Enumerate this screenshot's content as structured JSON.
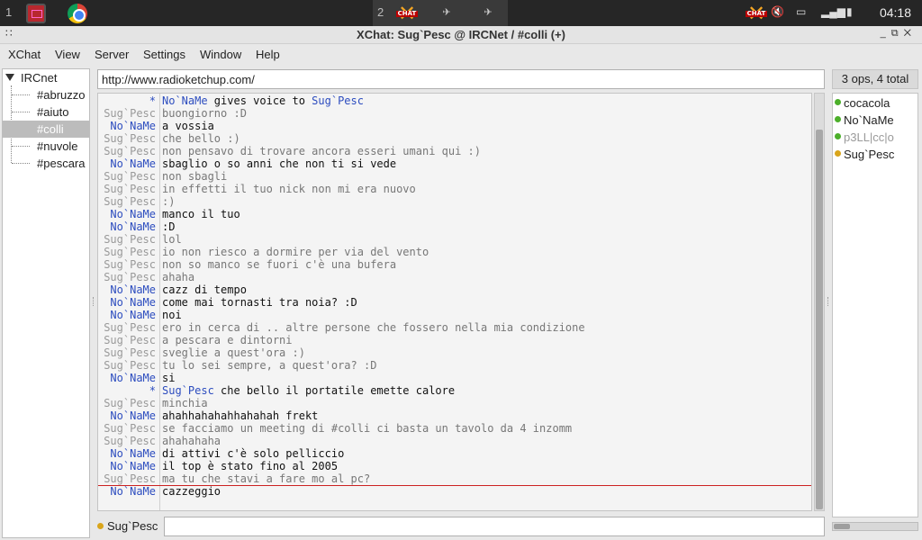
{
  "panel": {
    "workspace_1": "1",
    "workspace_2": "2",
    "xchat_icon_label": "CHAT",
    "clock": "04:18"
  },
  "window": {
    "title": "XChat: Sug`Pesc @ IRCNet / #colli (+)"
  },
  "menu": [
    "XChat",
    "View",
    "Server",
    "Settings",
    "Window",
    "Help"
  ],
  "tree": {
    "network": "IRCnet",
    "channels": [
      "#abruzzo",
      "#aiuto",
      "#colli",
      "#nuvole",
      "#pescara"
    ],
    "selected": "#colli"
  },
  "topic": "http://www.radioketchup.com/",
  "chat": [
    {
      "nick": "*",
      "text": "No`NaMe gives voice to Sug`Pesc",
      "kind": "action"
    },
    {
      "nick": "Sug`Pesc",
      "text": "buongiorno :D",
      "kind": "sug"
    },
    {
      "nick": "No`NaMe",
      "text": "a vossia",
      "kind": "no"
    },
    {
      "nick": "Sug`Pesc",
      "text": "che bello :)",
      "kind": "sug"
    },
    {
      "nick": "Sug`Pesc",
      "text": "non pensavo di trovare ancora esseri umani qui :)",
      "kind": "sug"
    },
    {
      "nick": "No`NaMe",
      "text": "sbaglio o so anni che non ti si vede",
      "kind": "no"
    },
    {
      "nick": "Sug`Pesc",
      "text": "non sbagli",
      "kind": "sug"
    },
    {
      "nick": "Sug`Pesc",
      "text": "in effetti il tuo nick non mi era nuovo",
      "kind": "sug"
    },
    {
      "nick": "Sug`Pesc",
      "text": ":)",
      "kind": "sug"
    },
    {
      "nick": "No`NaMe",
      "text": "manco il tuo",
      "kind": "no"
    },
    {
      "nick": "No`NaMe",
      "text": ":D",
      "kind": "no"
    },
    {
      "nick": "Sug`Pesc",
      "text": "lol",
      "kind": "sug"
    },
    {
      "nick": "Sug`Pesc",
      "text": "io non riesco a dormire per via del vento",
      "kind": "sug"
    },
    {
      "nick": "Sug`Pesc",
      "text": "non so manco se fuori c'è una bufera",
      "kind": "sug"
    },
    {
      "nick": "Sug`Pesc",
      "text": "ahaha",
      "kind": "sug"
    },
    {
      "nick": "No`NaMe",
      "text": "cazz di tempo",
      "kind": "no"
    },
    {
      "nick": "No`NaMe",
      "text": "come mai tornasti tra noia? :D",
      "kind": "no"
    },
    {
      "nick": "No`NaMe",
      "text": "noi",
      "kind": "no"
    },
    {
      "nick": "Sug`Pesc",
      "text": "ero in cerca di .. altre persone che fossero nella mia condizione",
      "kind": "sug"
    },
    {
      "nick": "Sug`Pesc",
      "text": "a pescara e dintorni",
      "kind": "sug"
    },
    {
      "nick": "Sug`Pesc",
      "text": "sveglie a quest'ora :)",
      "kind": "sug"
    },
    {
      "nick": "Sug`Pesc",
      "text": "tu lo sei sempre, a quest'ora? :D",
      "kind": "sug"
    },
    {
      "nick": "No`NaMe",
      "text": "si",
      "kind": "no"
    },
    {
      "nick": "*",
      "text": "Sug`Pesc che bello il portatile emette calore",
      "kind": "action"
    },
    {
      "nick": "Sug`Pesc",
      "text": "minchia",
      "kind": "sug"
    },
    {
      "nick": "No`NaMe",
      "text": "ahahhahahahhahahah frekt",
      "kind": "no"
    },
    {
      "nick": "Sug`Pesc",
      "text": "se facciamo un meeting di #colli ci basta un tavolo da 4 inzomm",
      "kind": "sug"
    },
    {
      "nick": "Sug`Pesc",
      "text": "ahahahaha",
      "kind": "sug"
    },
    {
      "nick": "No`NaMe",
      "text": "di attivi c'è solo pelliccio",
      "kind": "no"
    },
    {
      "nick": "No`NaMe",
      "text": "il top è stato fino al 2005",
      "kind": "no"
    },
    {
      "nick": "Sug`Pesc",
      "text": "ma tu che stavi a fare mo al pc?",
      "kind": "sug"
    },
    {
      "nick": "No`NaMe",
      "text": "cazzeggio",
      "kind": "no"
    }
  ],
  "input": {
    "nick": "Sug`Pesc",
    "value": ""
  },
  "users": {
    "count_label": "3 ops, 4 total",
    "list": [
      {
        "name": "cocacola",
        "color": "#4caf2a",
        "text_color": "#222222"
      },
      {
        "name": "No`NaMe",
        "color": "#4caf2a",
        "text_color": "#222222"
      },
      {
        "name": "p3LL|cc|o",
        "color": "#4caf2a",
        "text_color": "#9a9a9a"
      },
      {
        "name": "Sug`Pesc",
        "color": "#d9a51b",
        "text_color": "#222222"
      }
    ]
  }
}
